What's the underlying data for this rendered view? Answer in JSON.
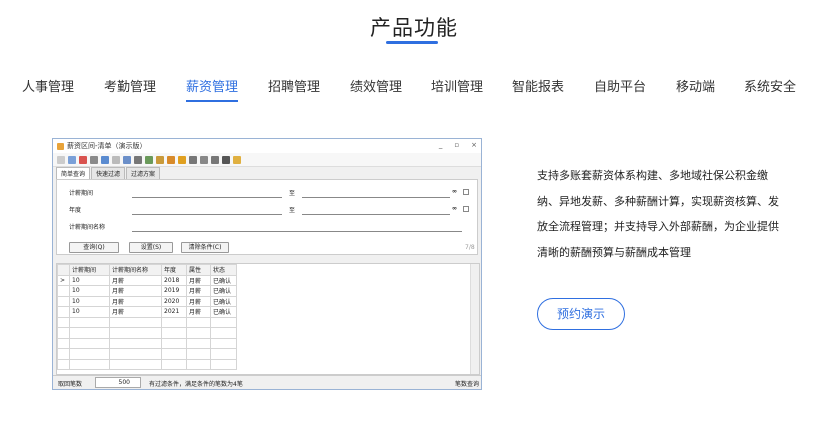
{
  "section": {
    "title": "产品功能"
  },
  "tabs": [
    {
      "label": "人事管理"
    },
    {
      "label": "考勤管理"
    },
    {
      "label": "薪资管理"
    },
    {
      "label": "招聘管理"
    },
    {
      "label": "绩效管理"
    },
    {
      "label": "培训管理"
    },
    {
      "label": "智能报表"
    },
    {
      "label": "自助平台"
    },
    {
      "label": "移动端"
    },
    {
      "label": "系统安全"
    }
  ],
  "active_tab": "薪资管理",
  "screenshot": {
    "window_title": "薪资区间-清单（演示版）",
    "controls": [
      "_",
      "▫",
      "×"
    ],
    "inner_tabs": [
      "简单查询",
      "快速过滤",
      "过滤方案"
    ],
    "form": {
      "label_period": "计薪期间",
      "label_year": "年度",
      "label_name": "计薪期间名称",
      "to": "至",
      "btn_query": "查询(Q)",
      "btn_settings": "设置(S)",
      "btn_clear": "清除条件(C)",
      "hint": "7/8"
    },
    "table": {
      "headers": [
        "计薪期间",
        "计薪期间名称",
        "年度",
        "属性",
        "状态"
      ],
      "rows": [
        [
          "10",
          "月薪",
          "2018",
          "月薪",
          "已确认"
        ],
        [
          "10",
          "月薪",
          "2019",
          "月薪",
          "已确认"
        ],
        [
          "10",
          "月薪",
          "2020",
          "月薪",
          "已确认"
        ],
        [
          "10",
          "月薪",
          "2021",
          "月薪",
          "已确认"
        ]
      ]
    },
    "status": {
      "label": "取回笔数",
      "count": "500",
      "message": "有过滤条件，满足条件的笔数为4笔",
      "right": "笔数查询"
    }
  },
  "description": "支持多账套薪资体系构建、多地域社保公积金缴纳、异地发薪、多种薪酬计算，实现薪资核算、发放全流程管理；并支持导入外部薪酬，为企业提供清晰的薪酬预算与薪酬成本管理",
  "demo_button": "预约演示"
}
